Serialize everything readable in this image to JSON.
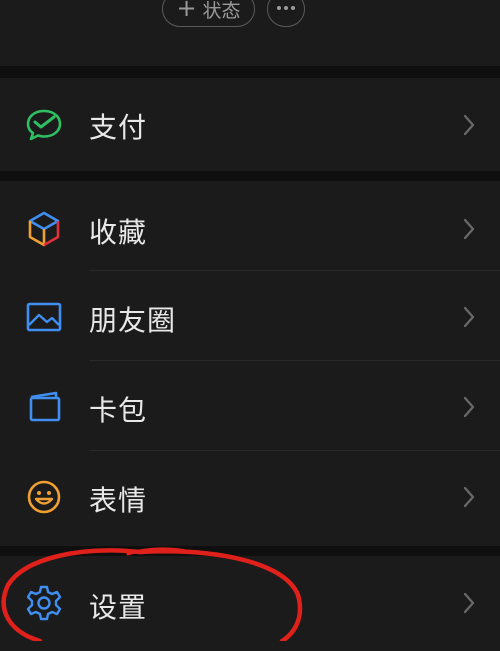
{
  "header": {
    "status_button": {
      "plus": "+",
      "label": "状态"
    },
    "more_button": {
      "icon": "ellipsis-icon"
    }
  },
  "menu": {
    "pay": {
      "label": "支付",
      "icon": "wechat-pay-icon",
      "icon_color": "#2fbf63"
    },
    "favorites": {
      "label": "收藏",
      "icon": "cube-icon"
    },
    "moments": {
      "label": "朋友圈",
      "icon": "image-icon",
      "icon_color": "#3f8ef0"
    },
    "cards": {
      "label": "卡包",
      "icon": "wallet-icon",
      "icon_color": "#3f8ef0"
    },
    "stickers": {
      "label": "表情",
      "icon": "smiley-icon",
      "icon_color": "#f0a030"
    },
    "settings": {
      "label": "设置",
      "icon": "gear-icon",
      "icon_color": "#3f8ef0"
    }
  },
  "annotation": {
    "color": "#e0201a",
    "shape": "hand-drawn-circle"
  }
}
